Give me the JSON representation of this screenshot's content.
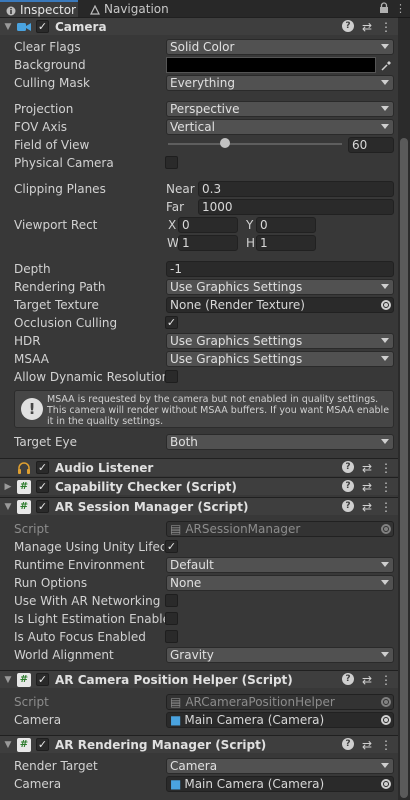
{
  "tabs": [
    {
      "label": "Inspector",
      "active": true
    },
    {
      "label": "Navigation",
      "active": false
    }
  ],
  "camera": {
    "title": "Camera",
    "clear_flags": {
      "label": "Clear Flags",
      "value": "Solid Color"
    },
    "background": {
      "label": "Background",
      "color": "#000000"
    },
    "culling_mask": {
      "label": "Culling Mask",
      "value": "Everything"
    },
    "projection": {
      "label": "Projection",
      "value": "Perspective"
    },
    "fov_axis": {
      "label": "FOV Axis",
      "value": "Vertical"
    },
    "field_of_view": {
      "label": "Field of View",
      "value": "60",
      "fraction": 0.33
    },
    "physical_camera": {
      "label": "Physical Camera",
      "checked": false
    },
    "clipping_planes": {
      "label": "Clipping Planes",
      "near_label": "Near",
      "near": "0.3",
      "far_label": "Far",
      "far": "1000"
    },
    "viewport_rect": {
      "label": "Viewport Rect",
      "x_label": "X",
      "x": "0",
      "y_label": "Y",
      "y": "0",
      "w_label": "W",
      "w": "1",
      "h_label": "H",
      "h": "1"
    },
    "depth": {
      "label": "Depth",
      "value": "-1"
    },
    "rendering_path": {
      "label": "Rendering Path",
      "value": "Use Graphics Settings"
    },
    "target_texture": {
      "label": "Target Texture",
      "value": "None (Render Texture)"
    },
    "occlusion_culling": {
      "label": "Occlusion Culling",
      "checked": true
    },
    "hdr": {
      "label": "HDR",
      "value": "Use Graphics Settings"
    },
    "msaa": {
      "label": "MSAA",
      "value": "Use Graphics Settings"
    },
    "allow_dynamic_resolution": {
      "label": "Allow Dynamic Resolution",
      "checked": false
    },
    "msaa_help": "MSAA is requested by the camera but not enabled in quality settings. This camera will render without MSAA buffers. If you want MSAA enable it in the quality settings.",
    "target_eye": {
      "label": "Target Eye",
      "value": "Both"
    }
  },
  "audio_listener": {
    "title": "Audio Listener"
  },
  "capability_checker": {
    "title": "Capability Checker (Script)"
  },
  "ar_session_manager": {
    "title": "AR Session Manager (Script)",
    "script": {
      "label": "Script",
      "value": "ARSessionManager"
    },
    "manage_lifecycle": {
      "label": "Manage Using Unity Lifecycle",
      "checked": true
    },
    "runtime_environment": {
      "label": "Runtime Environment",
      "value": "Default"
    },
    "run_options": {
      "label": "Run Options",
      "value": "None"
    },
    "use_networking": {
      "label": "Use With AR Networking Session",
      "checked": false
    },
    "light_estimation": {
      "label": "Is Light Estimation Enabled",
      "checked": false
    },
    "auto_focus": {
      "label": "Is Auto Focus Enabled",
      "checked": false
    },
    "world_alignment": {
      "label": "World Alignment",
      "value": "Gravity"
    }
  },
  "ar_camera_position_helper": {
    "title": "AR Camera Position Helper (Script)",
    "script": {
      "label": "Script",
      "value": "ARCameraPositionHelper"
    },
    "camera": {
      "label": "Camera",
      "value": "Main Camera (Camera)"
    }
  },
  "ar_rendering_manager": {
    "title": "AR Rendering Manager (Script)",
    "render_target": {
      "label": "Render Target",
      "value": "Camera"
    },
    "camera": {
      "label": "Camera",
      "value": "Main Camera (Camera)"
    }
  },
  "colors": {
    "accent": "#3a79bb",
    "panel": "#383838",
    "header": "#3e3e3e"
  }
}
